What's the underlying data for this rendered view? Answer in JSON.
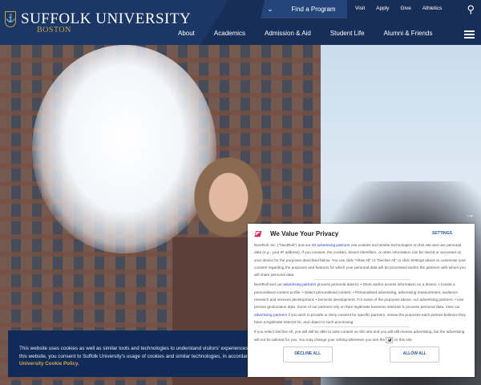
{
  "header": {
    "logo_name": "SUFFOLK UNIVERSITY",
    "logo_sub": "BOSTON",
    "find_program": "Find a Program",
    "utility": [
      "Visit",
      "Apply",
      "Give",
      "Athletics"
    ],
    "nav": [
      "About",
      "Academics",
      "Admission & Aid",
      "Student Life",
      "Alumni & Friends"
    ]
  },
  "cookie_banner": {
    "line1": "This website uses cookies as well as similar tools and technologies to understand visitors' experiences. By continuing to use",
    "line2": "this website, you consent to Suffolk University's usage of cookies and similar technologies, in accordance with the Suffolk",
    "link": "University Cookie Policy",
    "end": "."
  },
  "privacy": {
    "title": "We Value Your Privacy",
    "settings": "SETTINGS",
    "p1_a": "NextRoll, Inc. (\"NextRoll\") and our ",
    "p1_link": "20 advertising partners",
    "p1_b": " use cookies and similar technologies on this site and use personal data (e.g., your IP address). If you consent, the cookies, device identifiers, or other information can be stored or accessed on your device for the purposes described below. You can click \"Allow All\" or \"Decline All\" or click Settings above to customise your consent regarding the purposes and features for which your personal data will be processed and/or the partners with whom you will share personal data.",
    "p2_a": "NextRoll and our ",
    "p2_link": "advertising partners",
    "p2_b": " process personal data to: • Store and/or access information on a device; • Create a personalised content profile; • Select personalised content; • Personalised advertising, advertising measurement, audience research and services development; • Services development. For some of the purposes above, our advertising partners: • Use precise geolocation data. Some of our partners rely on their legitimate business interests to process personal data. View our ",
    "p2_link2": "advertising partners",
    "p2_c": " if you wish to provide or deny consent for specific partners, review the purposes each partner believes they have a legitimate interest for, and object to such processing.",
    "p3_a": "If you select Decline All, you will still be able to view content on this site and you will still receive advertising, but the advertising will not be tailored for you. You may change your setting whenever you see the ",
    "p3_b": " on this site.",
    "decline": "DECLINE ALL",
    "allow": "ALLOW ALL"
  }
}
